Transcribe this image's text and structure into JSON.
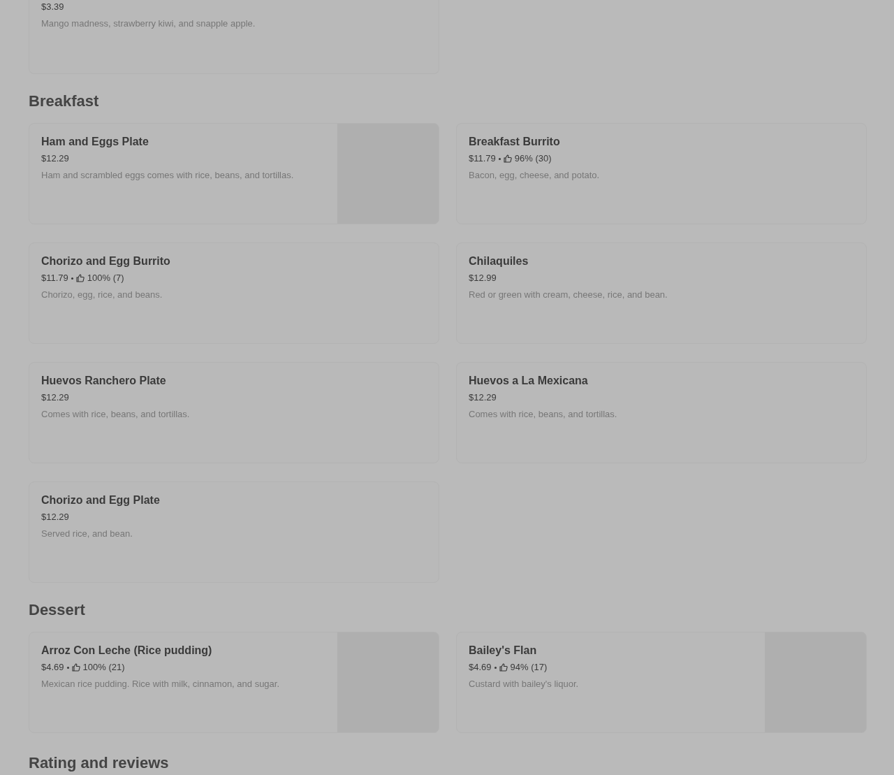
{
  "top_item": {
    "price": "$3.39",
    "description": "Mango madness, strawberry kiwi, and snapple apple."
  },
  "sections": [
    {
      "title": "Breakfast",
      "items": [
        {
          "name": "Ham and Eggs Plate",
          "price": "$12.29",
          "description": "Ham and scrambled eggs comes with rice, beans, and tortillas."
        },
        {
          "name": "Breakfast Burrito",
          "price": "$11.79",
          "rating": "96% (30)",
          "description": "Bacon, egg, cheese, and potato."
        },
        {
          "name": "Chorizo and Egg Burrito",
          "price": "$11.79",
          "rating": "100% (7)",
          "description": "Chorizo, egg, rice, and beans."
        },
        {
          "name": "Chilaquiles",
          "price": "$12.99",
          "description": "Red or green with cream, cheese, rice, and bean."
        },
        {
          "name": "Huevos Ranchero Plate",
          "price": "$12.29",
          "description": "Comes with rice, beans, and tortillas."
        },
        {
          "name": "Huevos a La Mexicana",
          "price": "$12.29",
          "description": "Comes with rice, beans, and tortillas."
        },
        {
          "name": "Chorizo and Egg Plate",
          "price": "$12.29",
          "description": "Served rice, and bean."
        }
      ]
    },
    {
      "title": "Dessert",
      "items": [
        {
          "name": "Arroz Con Leche (Rice pudding)",
          "price": "$4.69",
          "rating": "100% (21)",
          "description": "Mexican rice pudding. Rice with milk, cinnamon, and sugar."
        },
        {
          "name": "Bailey's Flan",
          "price": "$4.69",
          "rating": "94% (17)",
          "description": "Custard with bailey's liquor."
        }
      ]
    }
  ],
  "footer_heading": "Rating and reviews"
}
